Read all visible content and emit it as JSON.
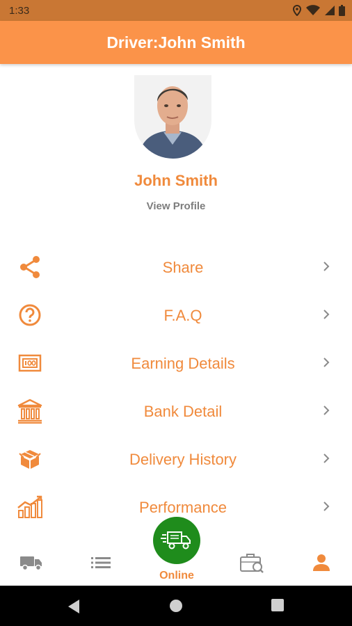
{
  "status_bar": {
    "time": "1:33",
    "icons": [
      "location-icon",
      "wifi-icon",
      "signal-icon",
      "battery-icon"
    ]
  },
  "app_bar": {
    "title": "Driver:John Smith"
  },
  "profile": {
    "name": "John Smith",
    "view_profile_label": "View Profile"
  },
  "menu": {
    "items": [
      {
        "label": "Share",
        "icon": "share-icon"
      },
      {
        "label": "F.A.Q",
        "icon": "help-circle-icon"
      },
      {
        "label": "Earning Details",
        "icon": "banknote-icon"
      },
      {
        "label": "Bank Detail",
        "icon": "bank-icon"
      },
      {
        "label": "Delivery History",
        "icon": "package-icon"
      },
      {
        "label": "Performance",
        "icon": "growth-chart-icon"
      }
    ]
  },
  "bottom_nav": {
    "online_label": "Online",
    "items": [
      "truck-icon",
      "list-icon",
      "delivery-truck-icon",
      "briefcase-icon",
      "person-icon"
    ],
    "active": "person-icon"
  },
  "colors": {
    "accent": "#fb9349",
    "text_accent": "#f08a3c",
    "status_bar": "#c97734",
    "online": "#1f8c1c",
    "muted": "#7d7d7d"
  }
}
